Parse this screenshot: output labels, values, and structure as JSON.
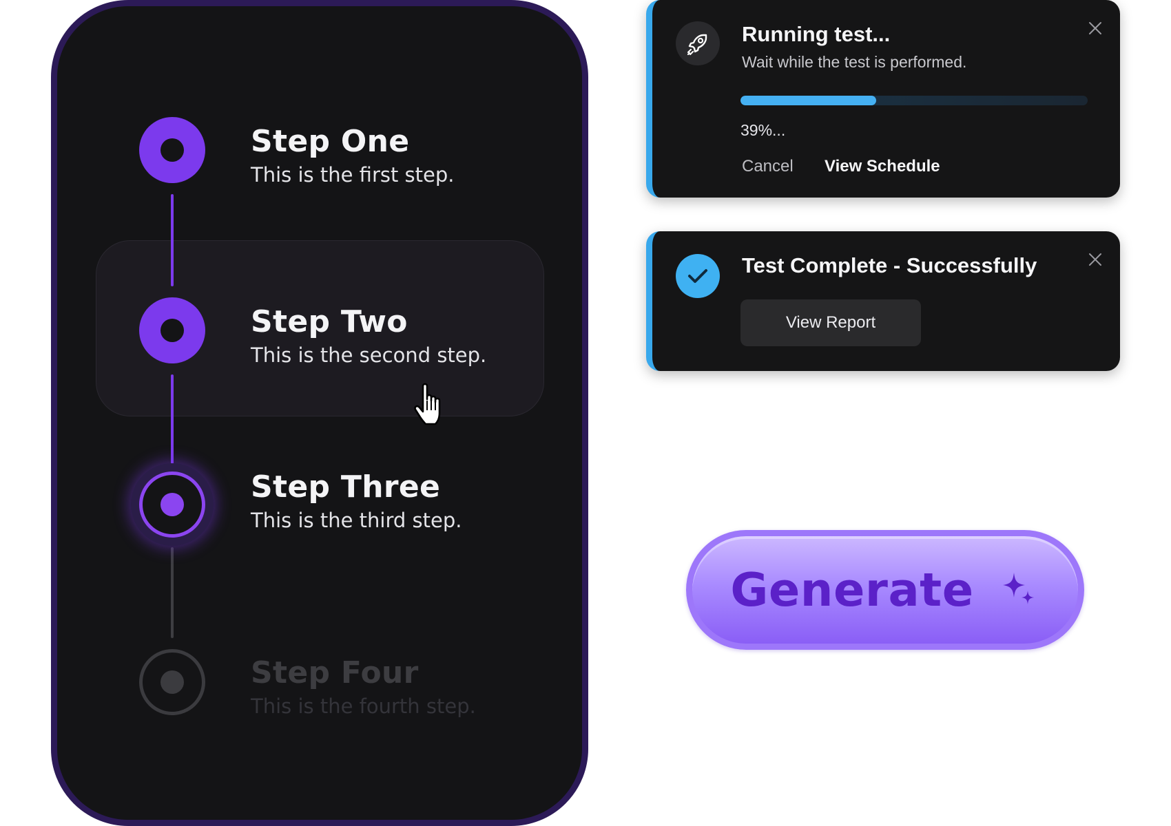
{
  "stepper": {
    "steps": [
      {
        "title": "Step One",
        "description": "This is the first step.",
        "state": "complete"
      },
      {
        "title": "Step Two",
        "description": "This is the second step.",
        "state": "complete"
      },
      {
        "title": "Step Three",
        "description": "This is the third step.",
        "state": "current"
      },
      {
        "title": "Step Four",
        "description": "This is the fourth step.",
        "state": "upcoming"
      }
    ]
  },
  "toast_running": {
    "title": "Running test...",
    "subtitle": "Wait while the test is performed.",
    "progress_percent": 39,
    "progress_text": "39%...",
    "cancel_label": "Cancel",
    "schedule_label": "View Schedule",
    "icon": "rocket-icon"
  },
  "toast_complete": {
    "title": "Test Complete - Successfully",
    "report_label": "View Report",
    "icon": "check-icon"
  },
  "generate": {
    "label": "Generate",
    "icon": "sparkle-icon"
  },
  "colors": {
    "accent_purple": "#7c3aed",
    "info_blue": "#45b0f2",
    "panel_dark": "#141416"
  }
}
